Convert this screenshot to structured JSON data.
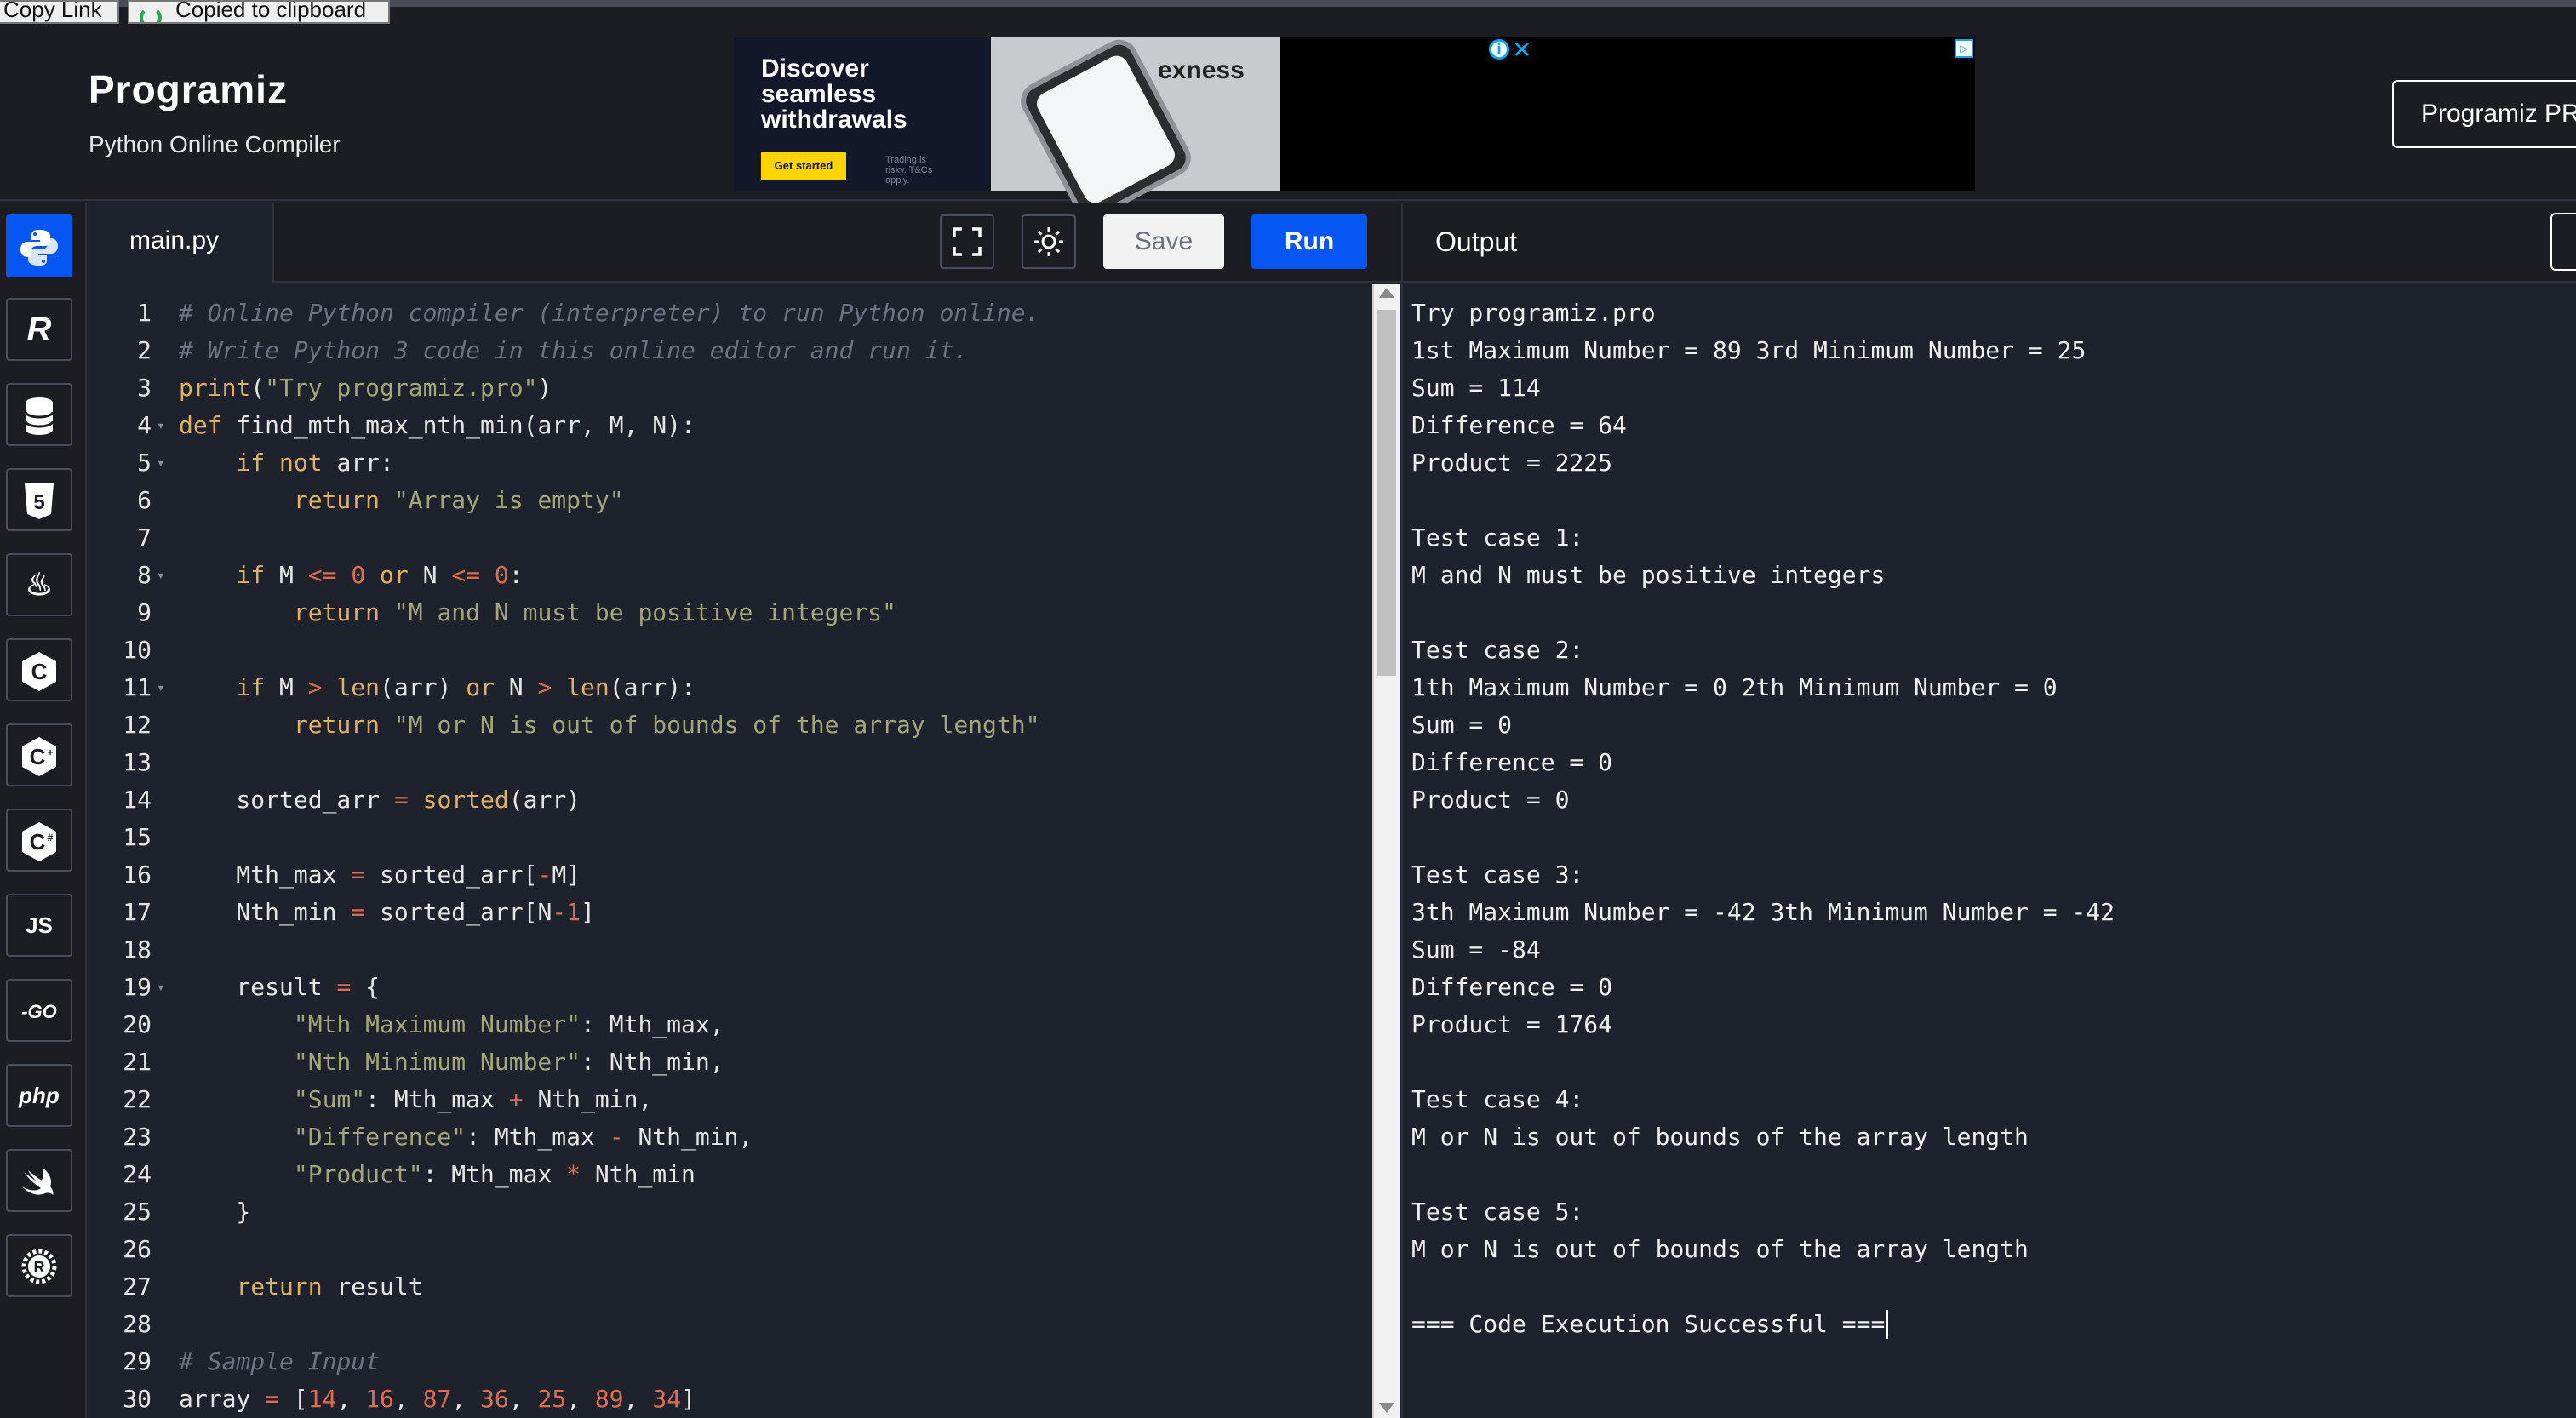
{
  "topbar": {
    "copy_link": "Copy Link",
    "copied": "Copied to clipboard"
  },
  "header": {
    "logo": "Programiz",
    "subtitle": "Python Online Compiler",
    "pro_button": "Programiz PRO"
  },
  "ad": {
    "headline": "Discover seamless withdrawals",
    "cta": "Get started",
    "fine_print": "Trading is risky. T&Cs apply.",
    "brand": "exness"
  },
  "sidebar": {
    "languages": [
      {
        "name": "python-icon",
        "label": "",
        "active": true
      },
      {
        "name": "r-icon",
        "label": "R",
        "active": false
      },
      {
        "name": "sql-icon",
        "label": "",
        "active": false
      },
      {
        "name": "html5-icon",
        "label": "5",
        "active": false
      },
      {
        "name": "java-icon",
        "label": "",
        "active": false
      },
      {
        "name": "c-icon",
        "label": "C",
        "active": false
      },
      {
        "name": "cpp-icon",
        "label": "C",
        "active": false
      },
      {
        "name": "csharp-icon",
        "label": "C",
        "active": false
      },
      {
        "name": "javascript-icon",
        "label": "JS",
        "active": false
      },
      {
        "name": "go-icon",
        "label": "GO",
        "active": false
      },
      {
        "name": "php-icon",
        "label": "php",
        "active": false
      },
      {
        "name": "swift-icon",
        "label": "",
        "active": false
      },
      {
        "name": "rust-icon",
        "label": "R",
        "active": false
      }
    ]
  },
  "editor": {
    "file_name": "main.py",
    "save_label": "Save",
    "run_label": "Run",
    "lines": [
      {
        "n": "1",
        "fold": false,
        "tokens": [
          [
            "comment",
            "# Online Python compiler (interpreter) to run Python online."
          ]
        ]
      },
      {
        "n": "2",
        "fold": false,
        "tokens": [
          [
            "comment",
            "# Write Python 3 code in this online editor and run it."
          ]
        ]
      },
      {
        "n": "3",
        "fold": false,
        "tokens": [
          [
            "fn",
            "print"
          ],
          [
            "plain",
            "("
          ],
          [
            "str",
            "\"Try programiz.pro\""
          ],
          [
            "plain",
            ")"
          ]
        ]
      },
      {
        "n": "4",
        "fold": true,
        "tokens": [
          [
            "kw",
            "def"
          ],
          [
            "plain",
            " find_mth_max_nth_min(arr, M, N):"
          ]
        ]
      },
      {
        "n": "5",
        "fold": true,
        "tokens": [
          [
            "plain",
            "    "
          ],
          [
            "kw",
            "if"
          ],
          [
            "plain",
            " "
          ],
          [
            "kw",
            "not"
          ],
          [
            "plain",
            " arr:"
          ]
        ]
      },
      {
        "n": "6",
        "fold": false,
        "tokens": [
          [
            "plain",
            "        "
          ],
          [
            "kw",
            "return"
          ],
          [
            "plain",
            " "
          ],
          [
            "str",
            "\"Array is empty\""
          ]
        ]
      },
      {
        "n": "7",
        "fold": false,
        "tokens": []
      },
      {
        "n": "8",
        "fold": true,
        "tokens": [
          [
            "plain",
            "    "
          ],
          [
            "kw",
            "if"
          ],
          [
            "plain",
            " M "
          ],
          [
            "op",
            "<="
          ],
          [
            "plain",
            " "
          ],
          [
            "num",
            "0"
          ],
          [
            "plain",
            " "
          ],
          [
            "kw",
            "or"
          ],
          [
            "plain",
            " N "
          ],
          [
            "op",
            "<="
          ],
          [
            "plain",
            " "
          ],
          [
            "num",
            "0"
          ],
          [
            "plain",
            ":"
          ]
        ]
      },
      {
        "n": "9",
        "fold": false,
        "tokens": [
          [
            "plain",
            "        "
          ],
          [
            "kw",
            "return"
          ],
          [
            "plain",
            " "
          ],
          [
            "str",
            "\"M and N must be positive integers\""
          ]
        ]
      },
      {
        "n": "10",
        "fold": false,
        "tokens": []
      },
      {
        "n": "11",
        "fold": true,
        "tokens": [
          [
            "plain",
            "    "
          ],
          [
            "kw",
            "if"
          ],
          [
            "plain",
            " M "
          ],
          [
            "op",
            ">"
          ],
          [
            "plain",
            " "
          ],
          [
            "fn",
            "len"
          ],
          [
            "plain",
            "(arr) "
          ],
          [
            "kw",
            "or"
          ],
          [
            "plain",
            " N "
          ],
          [
            "op",
            ">"
          ],
          [
            "plain",
            " "
          ],
          [
            "fn",
            "len"
          ],
          [
            "plain",
            "(arr):"
          ]
        ]
      },
      {
        "n": "12",
        "fold": false,
        "tokens": [
          [
            "plain",
            "        "
          ],
          [
            "kw",
            "return"
          ],
          [
            "plain",
            " "
          ],
          [
            "str",
            "\"M or N is out of bounds of the array length\""
          ]
        ]
      },
      {
        "n": "13",
        "fold": false,
        "tokens": []
      },
      {
        "n": "14",
        "fold": false,
        "tokens": [
          [
            "plain",
            "    sorted_arr "
          ],
          [
            "op",
            "="
          ],
          [
            "plain",
            " "
          ],
          [
            "fn",
            "sorted"
          ],
          [
            "plain",
            "(arr)"
          ]
        ]
      },
      {
        "n": "15",
        "fold": false,
        "tokens": []
      },
      {
        "n": "16",
        "fold": false,
        "tokens": [
          [
            "plain",
            "    Mth_max "
          ],
          [
            "op",
            "="
          ],
          [
            "plain",
            " sorted_arr["
          ],
          [
            "op",
            "-"
          ],
          [
            "plain",
            "M]"
          ]
        ]
      },
      {
        "n": "17",
        "fold": false,
        "tokens": [
          [
            "plain",
            "    Nth_min "
          ],
          [
            "op",
            "="
          ],
          [
            "plain",
            " sorted_arr[N"
          ],
          [
            "op",
            "-"
          ],
          [
            "num",
            "1"
          ],
          [
            "plain",
            "]"
          ]
        ]
      },
      {
        "n": "18",
        "fold": false,
        "tokens": []
      },
      {
        "n": "19",
        "fold": true,
        "tokens": [
          [
            "plain",
            "    result "
          ],
          [
            "op",
            "="
          ],
          [
            "plain",
            " {"
          ]
        ]
      },
      {
        "n": "20",
        "fold": false,
        "tokens": [
          [
            "plain",
            "        "
          ],
          [
            "str",
            "\"Mth Maximum Number\""
          ],
          [
            "plain",
            ": Mth_max,"
          ]
        ]
      },
      {
        "n": "21",
        "fold": false,
        "tokens": [
          [
            "plain",
            "        "
          ],
          [
            "str",
            "\"Nth Minimum Number\""
          ],
          [
            "plain",
            ": Nth_min,"
          ]
        ]
      },
      {
        "n": "22",
        "fold": false,
        "tokens": [
          [
            "plain",
            "        "
          ],
          [
            "str",
            "\"Sum\""
          ],
          [
            "plain",
            ": Mth_max "
          ],
          [
            "op",
            "+"
          ],
          [
            "plain",
            " Nth_min,"
          ]
        ]
      },
      {
        "n": "23",
        "fold": false,
        "tokens": [
          [
            "plain",
            "        "
          ],
          [
            "str",
            "\"Difference\""
          ],
          [
            "plain",
            ": Mth_max "
          ],
          [
            "op",
            "-"
          ],
          [
            "plain",
            " Nth_min,"
          ]
        ]
      },
      {
        "n": "24",
        "fold": false,
        "tokens": [
          [
            "plain",
            "        "
          ],
          [
            "str",
            "\"Product\""
          ],
          [
            "plain",
            ": Mth_max "
          ],
          [
            "op",
            "*"
          ],
          [
            "plain",
            " Nth_min"
          ]
        ]
      },
      {
        "n": "25",
        "fold": false,
        "tokens": [
          [
            "plain",
            "    }"
          ]
        ]
      },
      {
        "n": "26",
        "fold": false,
        "tokens": []
      },
      {
        "n": "27",
        "fold": false,
        "tokens": [
          [
            "plain",
            "    "
          ],
          [
            "kw",
            "return"
          ],
          [
            "plain",
            " result"
          ]
        ]
      },
      {
        "n": "28",
        "fold": false,
        "tokens": []
      },
      {
        "n": "29",
        "fold": false,
        "tokens": [
          [
            "comment",
            "# Sample Input"
          ]
        ]
      },
      {
        "n": "30",
        "fold": false,
        "tokens": [
          [
            "plain",
            "array "
          ],
          [
            "op",
            "="
          ],
          [
            "plain",
            " ["
          ],
          [
            "num",
            "14"
          ],
          [
            "plain",
            ", "
          ],
          [
            "num",
            "16"
          ],
          [
            "plain",
            ", "
          ],
          [
            "num",
            "87"
          ],
          [
            "plain",
            ", "
          ],
          [
            "num",
            "36"
          ],
          [
            "plain",
            ", "
          ],
          [
            "num",
            "25"
          ],
          [
            "plain",
            ", "
          ],
          [
            "num",
            "89"
          ],
          [
            "plain",
            ", "
          ],
          [
            "num",
            "34"
          ],
          [
            "plain",
            "]"
          ]
        ]
      }
    ]
  },
  "output": {
    "title": "Output",
    "lines": [
      "Try programiz.pro",
      "1st Maximum Number = 89 3rd Minimum Number = 25",
      "Sum = 114",
      "Difference = 64",
      "Product = 2225",
      "",
      "Test case 1:",
      "M and N must be positive integers",
      "",
      "Test case 2:",
      "1th Maximum Number = 0 2th Minimum Number = 0",
      "Sum = 0",
      "Difference = 0",
      "Product = 0",
      "",
      "Test case 3:",
      "3th Maximum Number = -42 3th Minimum Number = -42",
      "Sum = -84",
      "Difference = 0",
      "Product = 1764",
      "",
      "Test case 4:",
      "M or N is out of bounds of the array length",
      "",
      "Test case 5:",
      "M or N is out of bounds of the array length",
      "",
      "=== Code Execution Successful ==="
    ]
  }
}
